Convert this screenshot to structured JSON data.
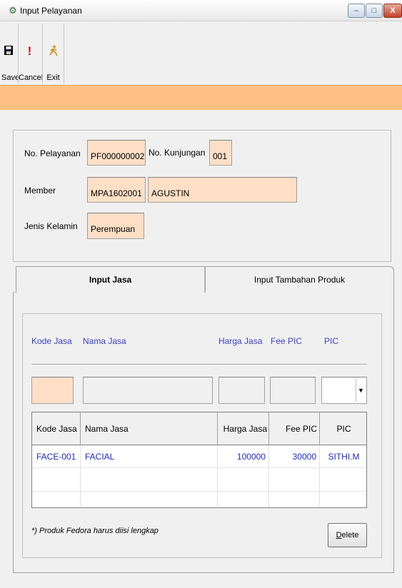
{
  "window": {
    "title": "Input Pelayanan",
    "app_icon": "settings-gear-icon",
    "controls": {
      "minimize": "–",
      "maximize": "□",
      "close": "X"
    }
  },
  "toolbar": {
    "save": {
      "label": "Save",
      "icon": "floppy-disk-icon",
      "glyph": "💾"
    },
    "cancel": {
      "label": "Cancel",
      "icon": "exclamation-icon",
      "glyph": "!"
    },
    "exit": {
      "label": "Exit",
      "icon": "running-man-icon",
      "glyph": "🏃"
    }
  },
  "header": {
    "no_pelayanan_label": "No. Pelayanan",
    "no_pelayanan_value": "PF000000002",
    "no_kunjungan_label": "No. Kunjungan",
    "no_kunjungan_value": "001",
    "member_label": "Member",
    "member_code": "MPA1602001",
    "member_name": "AGUSTIN",
    "jenis_kelamin_label": "Jenis Kelamin",
    "jenis_kelamin_value": "Perempuan"
  },
  "tabs": [
    {
      "label": "Input Jasa",
      "active": true
    },
    {
      "label": "Input Tambahan Produk",
      "active": false
    }
  ],
  "input_jasa": {
    "labels": {
      "kode_jasa": "Kode Jasa",
      "nama_jasa": "Nama Jasa",
      "harga_jasa": "Harga Jasa",
      "fee_pic": "Fee PIC",
      "pic": "PIC"
    },
    "pic_dropdown_arrow": "▼",
    "grid": {
      "columns": [
        "Kode Jasa",
        "Nama Jasa",
        "Harga Jasa",
        "Fee PIC",
        "PIC"
      ],
      "rows": [
        {
          "kode_jasa": "FACE-001",
          "nama_jasa": "FACIAL",
          "harga_jasa": "100000",
          "fee_pic": "30000",
          "pic": "SITHI.M"
        }
      ]
    },
    "note": "*) Produk Fedora harus diisi lengkap",
    "delete_button": {
      "before": "",
      "underlined": "D",
      "after": "elete"
    }
  },
  "colors": {
    "accent_orange": "#ffc183",
    "field_peach": "#ffdfc6",
    "label_blue": "#3a40c8",
    "value_blue": "#2028c8"
  }
}
